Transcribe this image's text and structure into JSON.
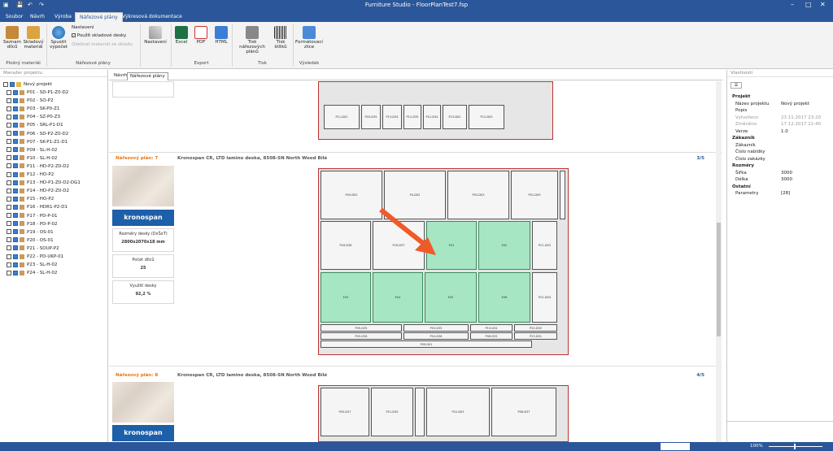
{
  "app": {
    "title": "Furniture Studio - FloorPlanTest7.fsp"
  },
  "tabs": [
    "Soubor",
    "Návrh",
    "Výroba",
    "Nářezové plány",
    "Výkresová dokumentace"
  ],
  "ribbon": {
    "seznam": "Seznam dílců",
    "skladovy": "Skladový materiál",
    "spustit": "Spustit výpočet",
    "nastaveni_label": "Nastavení",
    "pouzit": "Použít skladové desky",
    "odebrat": "Odebrat materiál ze skladu",
    "nastaveni": "Nastavení",
    "excel": "Excel",
    "pdf": "PDF",
    "html": "HTML",
    "tisk_plan": "Tisk nářezových plánů",
    "tisk_stitku": "Tisk štítků",
    "formatovaci": "Formátovací zlice",
    "grp_plosny": "Plošný materiál",
    "grp_narezove": "Nářezové plány",
    "grp_export": "Export",
    "grp_tisk": "Tisk",
    "grp_vysledek": "Výsledek"
  },
  "left_panel": {
    "header": "Manažer projektu",
    "root": "Nový projekt",
    "items": [
      "P01 - SD-P1-Z0-D2",
      "P02 - SO-P2",
      "P03 - SK-P0-Z1",
      "P04 - SZ-P0-Z3",
      "P05 - SRL-P1-D1",
      "P06 - SD-P2-Z0-D2",
      "P07 - SK-P1-Z1-D1",
      "P09 - SL-H-02",
      "P10 - SL-H-02",
      "P11 - HD-P2-Z0-D2",
      "P12 - HO-P2",
      "P13 - HD-P1-Z0-D2-DG1",
      "P14 - HD-P2-Z0-D2",
      "P15 - HO-P2",
      "P16 - HDR1-P2-D1",
      "P17 - PD-P-01",
      "P18 - PD-P-02",
      "P19 - OS-01",
      "P20 - OS-01",
      "P21 - SOUP-P2",
      "P22 - PD-UKP-01",
      "P23 - SL-H-02",
      "P24 - SL-H-02"
    ]
  },
  "center": {
    "doc_tabs": [
      "Návrh",
      "Nářezové plány"
    ],
    "plan7": {
      "label": "Nářezový plán: 7",
      "desc": "Kronospan CR, LTD lamino deska, 8508-SN North Wood Bílé",
      "num": "3/5"
    },
    "plan8": {
      "label": "Nářezový plán: 8",
      "desc": "Kronospan CR, LTD lamino deska, 8508-SN North Wood Bílé",
      "num": "4/5"
    },
    "logo": "kronospan",
    "rozmery_label": "Rozměry desky (DxŠxT)",
    "rozmery_value": "2800x2070x18 mm",
    "pocet_label": "Počet dílců",
    "pocet_value": "25",
    "vyuziti_label": "Využití desky",
    "vyuziti_value": "92,2 %"
  },
  "right_panel": {
    "header": "Vlastnosti",
    "rows": [
      {
        "k": "Projekt",
        "v": "",
        "style": "b"
      },
      {
        "k": "Název projektu",
        "v": "Nový projekt",
        "style": ""
      },
      {
        "k": "Popis",
        "v": "",
        "style": ""
      },
      {
        "k": "Vytvořeno",
        "v": "23.11.2017 23:20",
        "style": "gray"
      },
      {
        "k": "Změněno",
        "v": "17.12.2017 22:40",
        "style": "gray"
      },
      {
        "k": "Verze",
        "v": "1.0",
        "style": ""
      },
      {
        "k": "Zákazník",
        "v": "",
        "style": "b"
      },
      {
        "k": "Zákazník",
        "v": "",
        "style": ""
      },
      {
        "k": "Číslo nabídky",
        "v": "",
        "style": ""
      },
      {
        "k": "Číslo zakázky",
        "v": "",
        "style": ""
      },
      {
        "k": "Rozměry",
        "v": "",
        "style": "b"
      },
      {
        "k": "Šířka",
        "v": "3000",
        "style": ""
      },
      {
        "k": "Délka",
        "v": "3000",
        "style": ""
      },
      {
        "k": "Ostatní",
        "v": "",
        "style": "b"
      },
      {
        "k": "Parametry",
        "v": "[28]",
        "style": ""
      }
    ]
  },
  "status": {
    "zoom": "100%"
  },
  "colors": {
    "accent": "#2b579a",
    "highlight": "#a6e6c3",
    "arrow": "#f05a28"
  }
}
